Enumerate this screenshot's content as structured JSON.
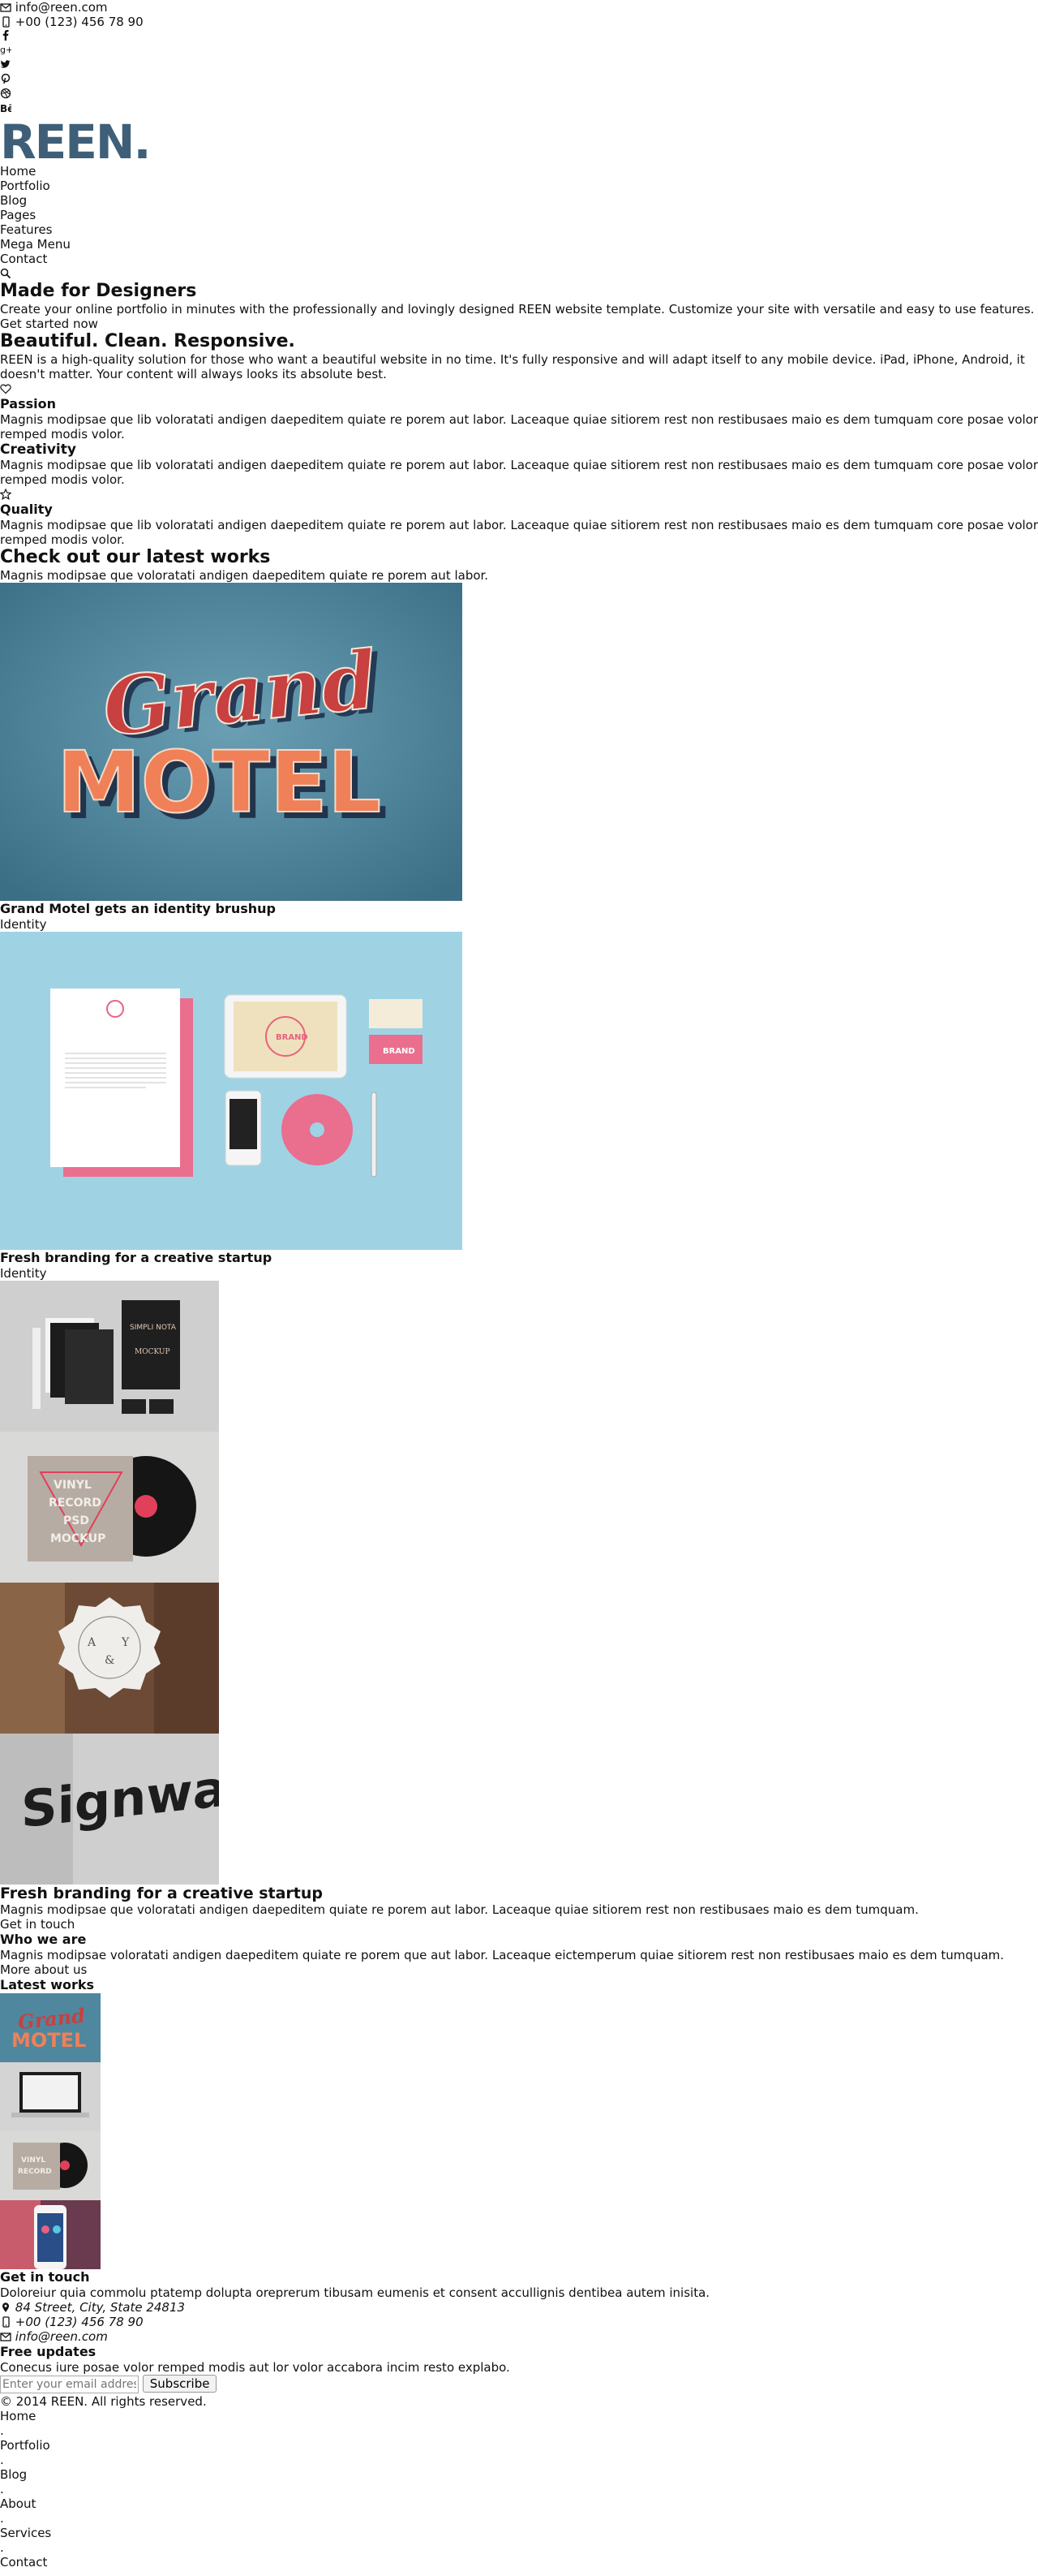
{
  "topbar": {
    "email": "info@reen.com",
    "phone": "+00 (123) 456 78 90",
    "social": [
      "facebook-icon",
      "google-plus-icon",
      "twitter-icon",
      "pinterest-icon",
      "dribbble-icon",
      "behance-icon"
    ]
  },
  "logo": "REEN.",
  "nav": [
    "Home",
    "Portfolio",
    "Blog",
    "Pages",
    "Features",
    "Mega Menu",
    "Contact"
  ],
  "hero": {
    "title": "Made for Designers",
    "text": "Create your online portfolio in minutes with the professionally and lovingly designed REEN website template. Customize your site with versatile and easy to use features.",
    "cta": "Get started now"
  },
  "intro": {
    "title": "Beautiful. Clean. Responsive.",
    "text": "REEN is a high-quality solution for those who want a beautiful website in no time. It's fully responsive and will adapt itself to any mobile device. iPad, iPhone, Android, it doesn't matter. Your content will always looks its absolute best."
  },
  "features": [
    {
      "title": "Passion",
      "text": "Magnis modipsae que lib voloratati andigen daepeditem quiate re porem aut labor. Laceaque quiae sitiorem rest non restibusaes maio es dem tumquam core posae volor remped modis volor."
    },
    {
      "title": "Creativity",
      "text": "Magnis modipsae que lib voloratati andigen daepeditem quiate re porem aut labor. Laceaque quiae sitiorem rest non restibusaes maio es dem tumquam core posae volor remped modis volor."
    },
    {
      "title": "Quality",
      "text": "Magnis modipsae que lib voloratati andigen daepeditem quiate re porem aut labor. Laceaque quiae sitiorem rest non restibusaes maio es dem tumquam core posae volor remped modis volor."
    }
  ],
  "works": {
    "title": "Check out our latest works",
    "text": "Magnis modipsae que voloratati andigen daepeditem quiate re porem aut labor.",
    "items": [
      {
        "title": "Grand Motel gets an identity brushup",
        "category": "Identity"
      },
      {
        "title": "Fresh branding for a creative startup",
        "category": "Identity"
      }
    ]
  },
  "gallery_text": {
    "title": "Fresh branding for a creative startup",
    "text": "Magnis modipsae que voloratati andigen daepeditem quiate re porem aut labor. Laceaque quiae sitiorem rest non restibusaes maio es dem tumquam.",
    "link": "Get in touch"
  },
  "who": {
    "title": "Who we are",
    "text": "Magnis modipsae voloratati andigen daepeditem quiate re porem que aut labor. Laceaque eictemperum quiae sitiorem rest non restibusaes maio es dem tumquam.",
    "link": "More about us"
  },
  "latest": {
    "title": "Latest works"
  },
  "contact": {
    "title": "Get in touch",
    "text": "Doloreiur quia commolu ptatemp dolupta oreprerum tibusam eumenis et consent accullignis dentibea autem inisita.",
    "address": "84 Street, City, State 24813",
    "phone": "+00 (123) 456 78 90",
    "email": "info@reen.com"
  },
  "newsletter": {
    "title": "Free updates",
    "text": "Conecus iure posae volor remped modis aut lor volor accabora incim resto explabo.",
    "placeholder": "Enter your email address",
    "button": "Subscribe"
  },
  "footer": {
    "copyright": "© 2014 REEN. All rights reserved.",
    "nav": [
      "Home",
      "Portfolio",
      "Blog",
      "About",
      "Services",
      "Contact"
    ],
    "separator": "."
  }
}
